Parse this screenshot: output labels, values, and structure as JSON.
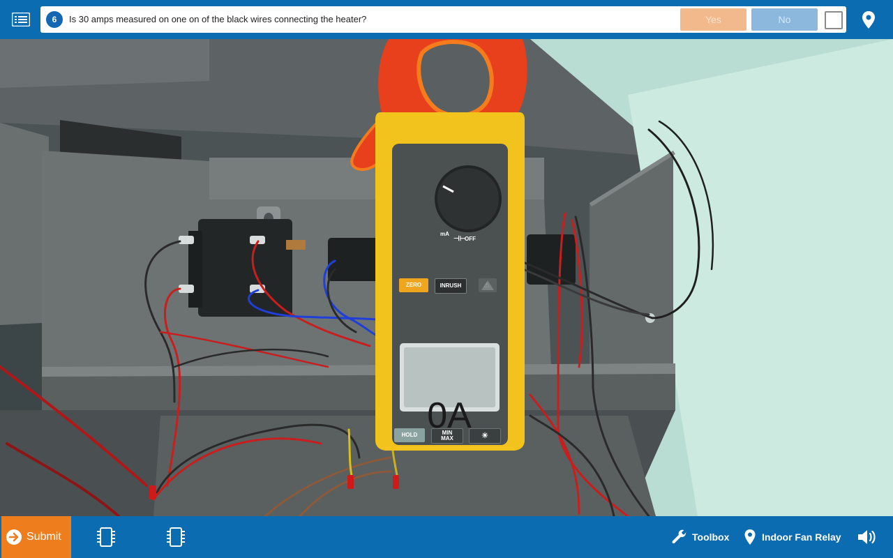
{
  "question": {
    "number": "6",
    "text": "Is 30 amps measured on one on of the black wires connecting the heater?",
    "yes_label": "Yes",
    "no_label": "No"
  },
  "meter": {
    "display_value": "0A",
    "dial_labels": {
      "off": "OFF",
      "ma": "mA"
    },
    "buttons": {
      "zero": "ZERO",
      "inrush": "INRUSH",
      "hold": "HOLD",
      "minmax": "MIN\nMAX"
    }
  },
  "bottom": {
    "submit_label": "Submit",
    "toolbox_label": "Toolbox",
    "location_label": "Indoor Fan Relay"
  },
  "colors": {
    "bar_blue": "#0b6cb2",
    "submit_orange": "#ee7d1e",
    "meter_yellow": "#f2c21d",
    "clamp_red": "#e8401d"
  }
}
